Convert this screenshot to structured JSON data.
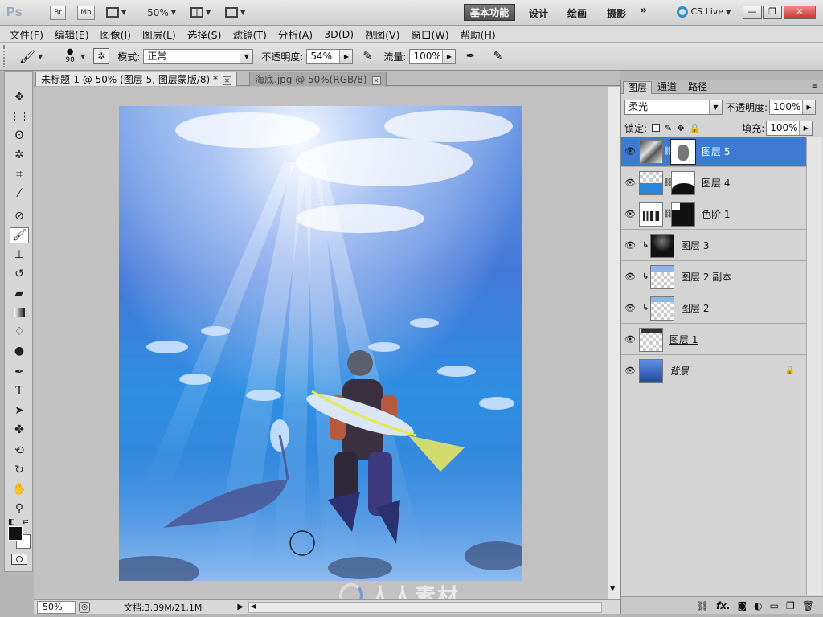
{
  "appbar": {
    "logo": "Ps",
    "bridge": "Br",
    "minibridge": "Mb",
    "zoom": "50%",
    "workspaces": [
      "基本功能",
      "设计",
      "绘画",
      "摄影"
    ],
    "more": "»",
    "cs_live": "CS Live",
    "min_label": "—",
    "max_label": "❐",
    "close_label": "✕"
  },
  "menu": [
    "文件(F)",
    "编辑(E)",
    "图像(I)",
    "图层(L)",
    "选择(S)",
    "滤镜(T)",
    "分析(A)",
    "3D(D)",
    "视图(V)",
    "窗口(W)",
    "帮助(H)"
  ],
  "options": {
    "brush_size": "90",
    "mode_label": "模式:",
    "mode_value": "正常",
    "opacity_label": "不透明度:",
    "opacity_value": "54%",
    "flow_label": "流量:",
    "flow_value": "100%"
  },
  "tabs": [
    {
      "label": "未标题-1 @ 50% (图层 5, 图层蒙版/8) *",
      "active": true
    },
    {
      "label": "海底.jpg @ 50%(RGB/8)",
      "active": false
    }
  ],
  "status": {
    "zoom": "50%",
    "doc": "文档:3.39M/21.1M"
  },
  "layers_panel": {
    "tabs": [
      "图层",
      "通道",
      "路径"
    ],
    "blend_mode": "柔光",
    "opacity_label": "不透明度:",
    "opacity_value": "100%",
    "lock_label": "锁定:",
    "fill_label": "填充:",
    "fill_value": "100%",
    "layers": [
      {
        "name": "图层 5",
        "selected": true,
        "clipped": false,
        "mask": true,
        "locked": false
      },
      {
        "name": "图层 4",
        "selected": false,
        "clipped": false,
        "mask": true,
        "locked": false
      },
      {
        "name": "色阶 1",
        "selected": false,
        "clipped": false,
        "mask": true,
        "locked": false
      },
      {
        "name": "图层 3",
        "selected": false,
        "clipped": true,
        "mask": false,
        "locked": false
      },
      {
        "name": "图层 2 副本",
        "selected": false,
        "clipped": true,
        "mask": false,
        "locked": false
      },
      {
        "name": "图层 2",
        "selected": false,
        "clipped": true,
        "mask": false,
        "locked": false
      },
      {
        "name": "图层 1",
        "selected": false,
        "clipped": false,
        "mask": false,
        "locked": false
      },
      {
        "name": "背景",
        "selected": false,
        "clipped": false,
        "mask": false,
        "locked": true
      }
    ]
  },
  "watermark": "人人素材",
  "colors": {
    "selection": "#3d7bd3",
    "water_top": "#4a7fd8",
    "water_bottom": "#2a8ee0"
  }
}
